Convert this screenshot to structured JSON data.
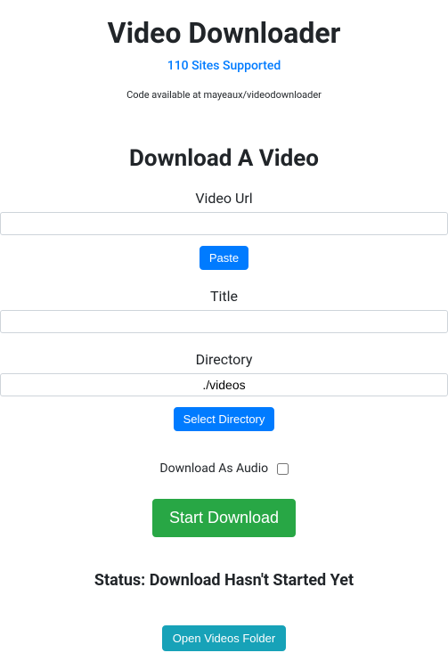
{
  "header": {
    "title": "Video Downloader",
    "sites_link": "110 Sites Supported",
    "code_note": "Code available at mayeaux/videodownloader"
  },
  "form": {
    "heading": "Download A Video",
    "video_url": {
      "label": "Video Url",
      "value": "",
      "paste_button": "Paste"
    },
    "title": {
      "label": "Title",
      "value": ""
    },
    "directory": {
      "label": "Directory",
      "value": "./videos",
      "select_button": "Select Directory"
    },
    "audio_checkbox": {
      "label": "Download As Audio",
      "checked": false
    },
    "start_button": "Start Download"
  },
  "status": {
    "prefix": "Status: ",
    "message": "Download Hasn't Started Yet"
  },
  "open_folder_button": "Open Videos Folder"
}
